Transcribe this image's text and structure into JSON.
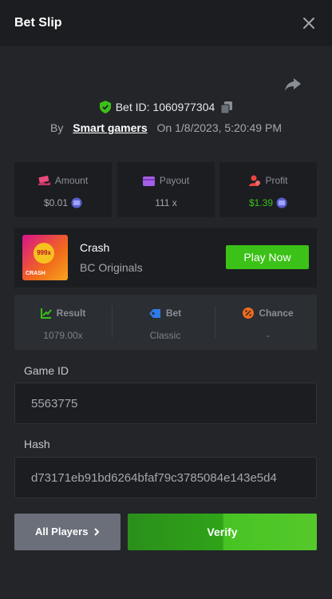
{
  "header": {
    "title": "Bet Slip",
    "close_icon": "close-icon"
  },
  "share_icon": "share-icon",
  "bet": {
    "id_label": "Bet ID: 1060977304",
    "by_label": "By",
    "user": "Smart gamers",
    "on_label": "On",
    "datetime": "1/8/2023, 5:20:49 PM"
  },
  "stats": {
    "amount": {
      "label": "Amount",
      "value": "$0.01",
      "icon": "cash-hand-icon",
      "color": "#e84a7a"
    },
    "payout": {
      "label": "Payout",
      "value": "111 x",
      "icon": "wallet-card-icon",
      "color": "#a55ee6"
    },
    "profit": {
      "label": "Profit",
      "value": "$1.39",
      "icon": "person-coin-icon",
      "color": "#e8463f",
      "value_color": "#3bc117"
    }
  },
  "game": {
    "name": "Crash",
    "provider": "BC Originals",
    "thumb_badge": "999x",
    "thumb_caption": "CRASH",
    "play_label": "Play Now"
  },
  "result": {
    "result": {
      "label": "Result",
      "value": "1079.00x",
      "icon": "chart-up-icon",
      "color": "#3bc117"
    },
    "bet": {
      "label": "Bet",
      "value": "Classic",
      "icon": "tag-icon",
      "color": "#2f7ae6"
    },
    "chance": {
      "label": "Chance",
      "value": "-",
      "icon": "percent-icon",
      "color": "#f26a1b"
    }
  },
  "fields": {
    "game_id": {
      "label": "Game ID",
      "value": "5563775"
    },
    "hash": {
      "label": "Hash",
      "value": "d73171eb91bd6264bfaf79c3785084e143e5d4"
    }
  },
  "actions": {
    "all_players": "All Players",
    "verify": "Verify"
  }
}
